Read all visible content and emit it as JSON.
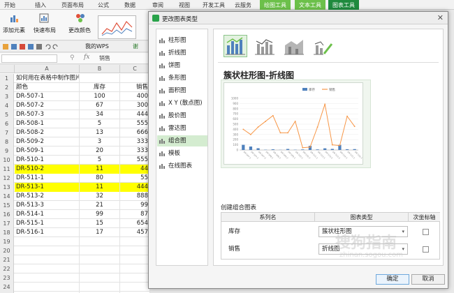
{
  "ribbon": {
    "tabs": [
      "开始",
      "插入",
      "页面布局",
      "公式",
      "数据",
      "审阅",
      "视图",
      "开发工具",
      "云服务",
      "绘图工具",
      "文本工具",
      "图表工具"
    ]
  },
  "toolbar": {
    "add_element": "添加元素",
    "quick_layout": "快速布局",
    "change_color": "更改颜色"
  },
  "qat": {
    "doc_tab": "我的WPS",
    "doc_tab2": "谢"
  },
  "formula_bar": {
    "fx": "fx",
    "value": "销售"
  },
  "sheet": {
    "columns": [
      "A",
      "B",
      "C"
    ],
    "rows": [
      {
        "n": "1",
        "a": "如何用在表格中制作图片",
        "b": "",
        "c": ""
      },
      {
        "n": "2",
        "a": "颜色",
        "b": "库存",
        "c": "销售"
      },
      {
        "n": "3",
        "a": "DR-507-1",
        "b": "100",
        "c": "400"
      },
      {
        "n": "4",
        "a": "DR-507-2",
        "b": "67",
        "c": "300"
      },
      {
        "n": "5",
        "a": "DR-507-3",
        "b": "34",
        "c": "444"
      },
      {
        "n": "6",
        "a": "DR-508-1",
        "b": "5",
        "c": "555"
      },
      {
        "n": "7",
        "a": "DR-508-2",
        "b": "13",
        "c": "666"
      },
      {
        "n": "8",
        "a": "DR-509-2",
        "b": "3",
        "c": "333"
      },
      {
        "n": "9",
        "a": "DR-509-1",
        "b": "20",
        "c": "333"
      },
      {
        "n": "10",
        "a": "DR-510-1",
        "b": "5",
        "c": "555"
      },
      {
        "n": "11",
        "a": "DR-510-2",
        "b": "11",
        "c": "44"
      },
      {
        "n": "12",
        "a": "DR-511-1",
        "b": "80",
        "c": "55"
      },
      {
        "n": "13",
        "a": "DR-513-1",
        "b": "11",
        "c": "444"
      },
      {
        "n": "14",
        "a": "DR-513-2",
        "b": "32",
        "c": "888"
      },
      {
        "n": "15",
        "a": "DR-513-3",
        "b": "21",
        "c": "99"
      },
      {
        "n": "16",
        "a": "DR-514-1",
        "b": "99",
        "c": "87"
      },
      {
        "n": "17",
        "a": "DR-515-1",
        "b": "15",
        "c": "654"
      },
      {
        "n": "18",
        "a": "DR-516-1",
        "b": "17",
        "c": "457"
      },
      {
        "n": "19",
        "a": "",
        "b": "",
        "c": ""
      },
      {
        "n": "20",
        "a": "",
        "b": "",
        "c": ""
      },
      {
        "n": "21",
        "a": "",
        "b": "",
        "c": ""
      },
      {
        "n": "22",
        "a": "",
        "b": "",
        "c": ""
      },
      {
        "n": "23",
        "a": "",
        "b": "",
        "c": ""
      },
      {
        "n": "24",
        "a": "",
        "b": "",
        "c": ""
      },
      {
        "n": "25",
        "a": "",
        "b": "",
        "c": ""
      }
    ],
    "highlight_rows": [
      "11",
      "13"
    ]
  },
  "dialog": {
    "title": "更改图表类型",
    "chart_types": [
      "柱形图",
      "折线图",
      "饼图",
      "条形图",
      "面积图",
      "X Y (散点图)",
      "股价图",
      "雷达图",
      "组合图",
      "模板",
      "在线图表"
    ],
    "selected_type": "组合图",
    "chart_title": "簇状柱形图-折线图",
    "combo_label": "创建组合图表",
    "table_headers": [
      "系列名",
      "图表类型",
      "次坐标轴"
    ],
    "series": [
      {
        "name": "库存",
        "type": "簇状柱形图"
      },
      {
        "name": "销售",
        "type": "折线图"
      }
    ],
    "ok": "确定",
    "cancel": "取消"
  },
  "watermark": {
    "text": "搜狗指南",
    "url": "zhinan.sogou.com"
  },
  "chart_data": {
    "type": "bar",
    "categories": [
      "DR-507-1",
      "DR-507-2",
      "DR-507-3",
      "DR-508-1",
      "DR-508-2",
      "DR-509-2",
      "DR-509-1",
      "DR-510-1",
      "DR-510-2",
      "DR-511-1",
      "DR-513-1",
      "DR-513-2",
      "DR-513-3",
      "DR-514-1",
      "DR-515-1",
      "DR-516-1"
    ],
    "series": [
      {
        "name": "库存",
        "values": [
          100,
          67,
          34,
          5,
          13,
          3,
          20,
          5,
          11,
          80,
          11,
          32,
          21,
          99,
          15,
          17
        ],
        "kind": "bar"
      },
      {
        "name": "销售",
        "values": [
          400,
          300,
          444,
          555,
          666,
          333,
          333,
          555,
          44,
          55,
          444,
          888,
          99,
          87,
          654,
          457
        ],
        "kind": "line"
      }
    ],
    "ylim": [
      0,
      1000
    ],
    "grid": true,
    "colors": {
      "bar": "#4f81bd",
      "line": "#f79646"
    }
  }
}
